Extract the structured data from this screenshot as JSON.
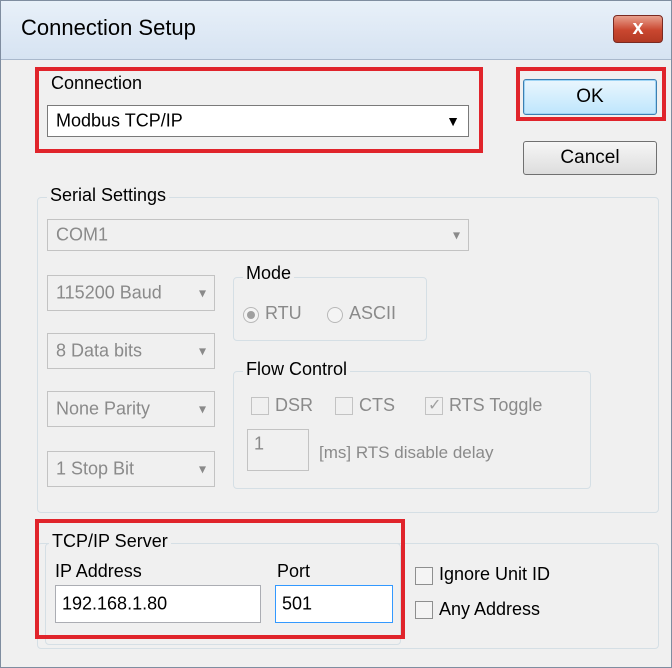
{
  "window": {
    "title": "Connection Setup",
    "close_glyph": "x"
  },
  "connection": {
    "label": "Connection",
    "value": "Modbus TCP/IP"
  },
  "buttons": {
    "ok": "OK",
    "cancel": "Cancel"
  },
  "serial": {
    "label": "Serial Settings",
    "port": "COM1",
    "baud": "115200 Baud",
    "data_bits": "8 Data bits",
    "parity": "None Parity",
    "stop_bits": "1 Stop Bit",
    "mode": {
      "label": "Mode",
      "options": [
        "RTU",
        "ASCII"
      ],
      "selected": "RTU"
    },
    "flow": {
      "label": "Flow Control",
      "dsr": "DSR",
      "cts": "CTS",
      "rts_toggle": "RTS Toggle",
      "delay_value": "1",
      "delay_label": "[ms] RTS disable delay"
    }
  },
  "tcp": {
    "label": "TCP/IP Server",
    "ip_label": "IP Address",
    "ip_value": "192.168.1.80",
    "port_label": "Port",
    "port_value": "501",
    "ignore_unit_id": "Ignore Unit ID",
    "any_address": "Any Address"
  },
  "colors": {
    "highlight": "#e0242b",
    "dialog_bg": "#f0f0f0"
  }
}
